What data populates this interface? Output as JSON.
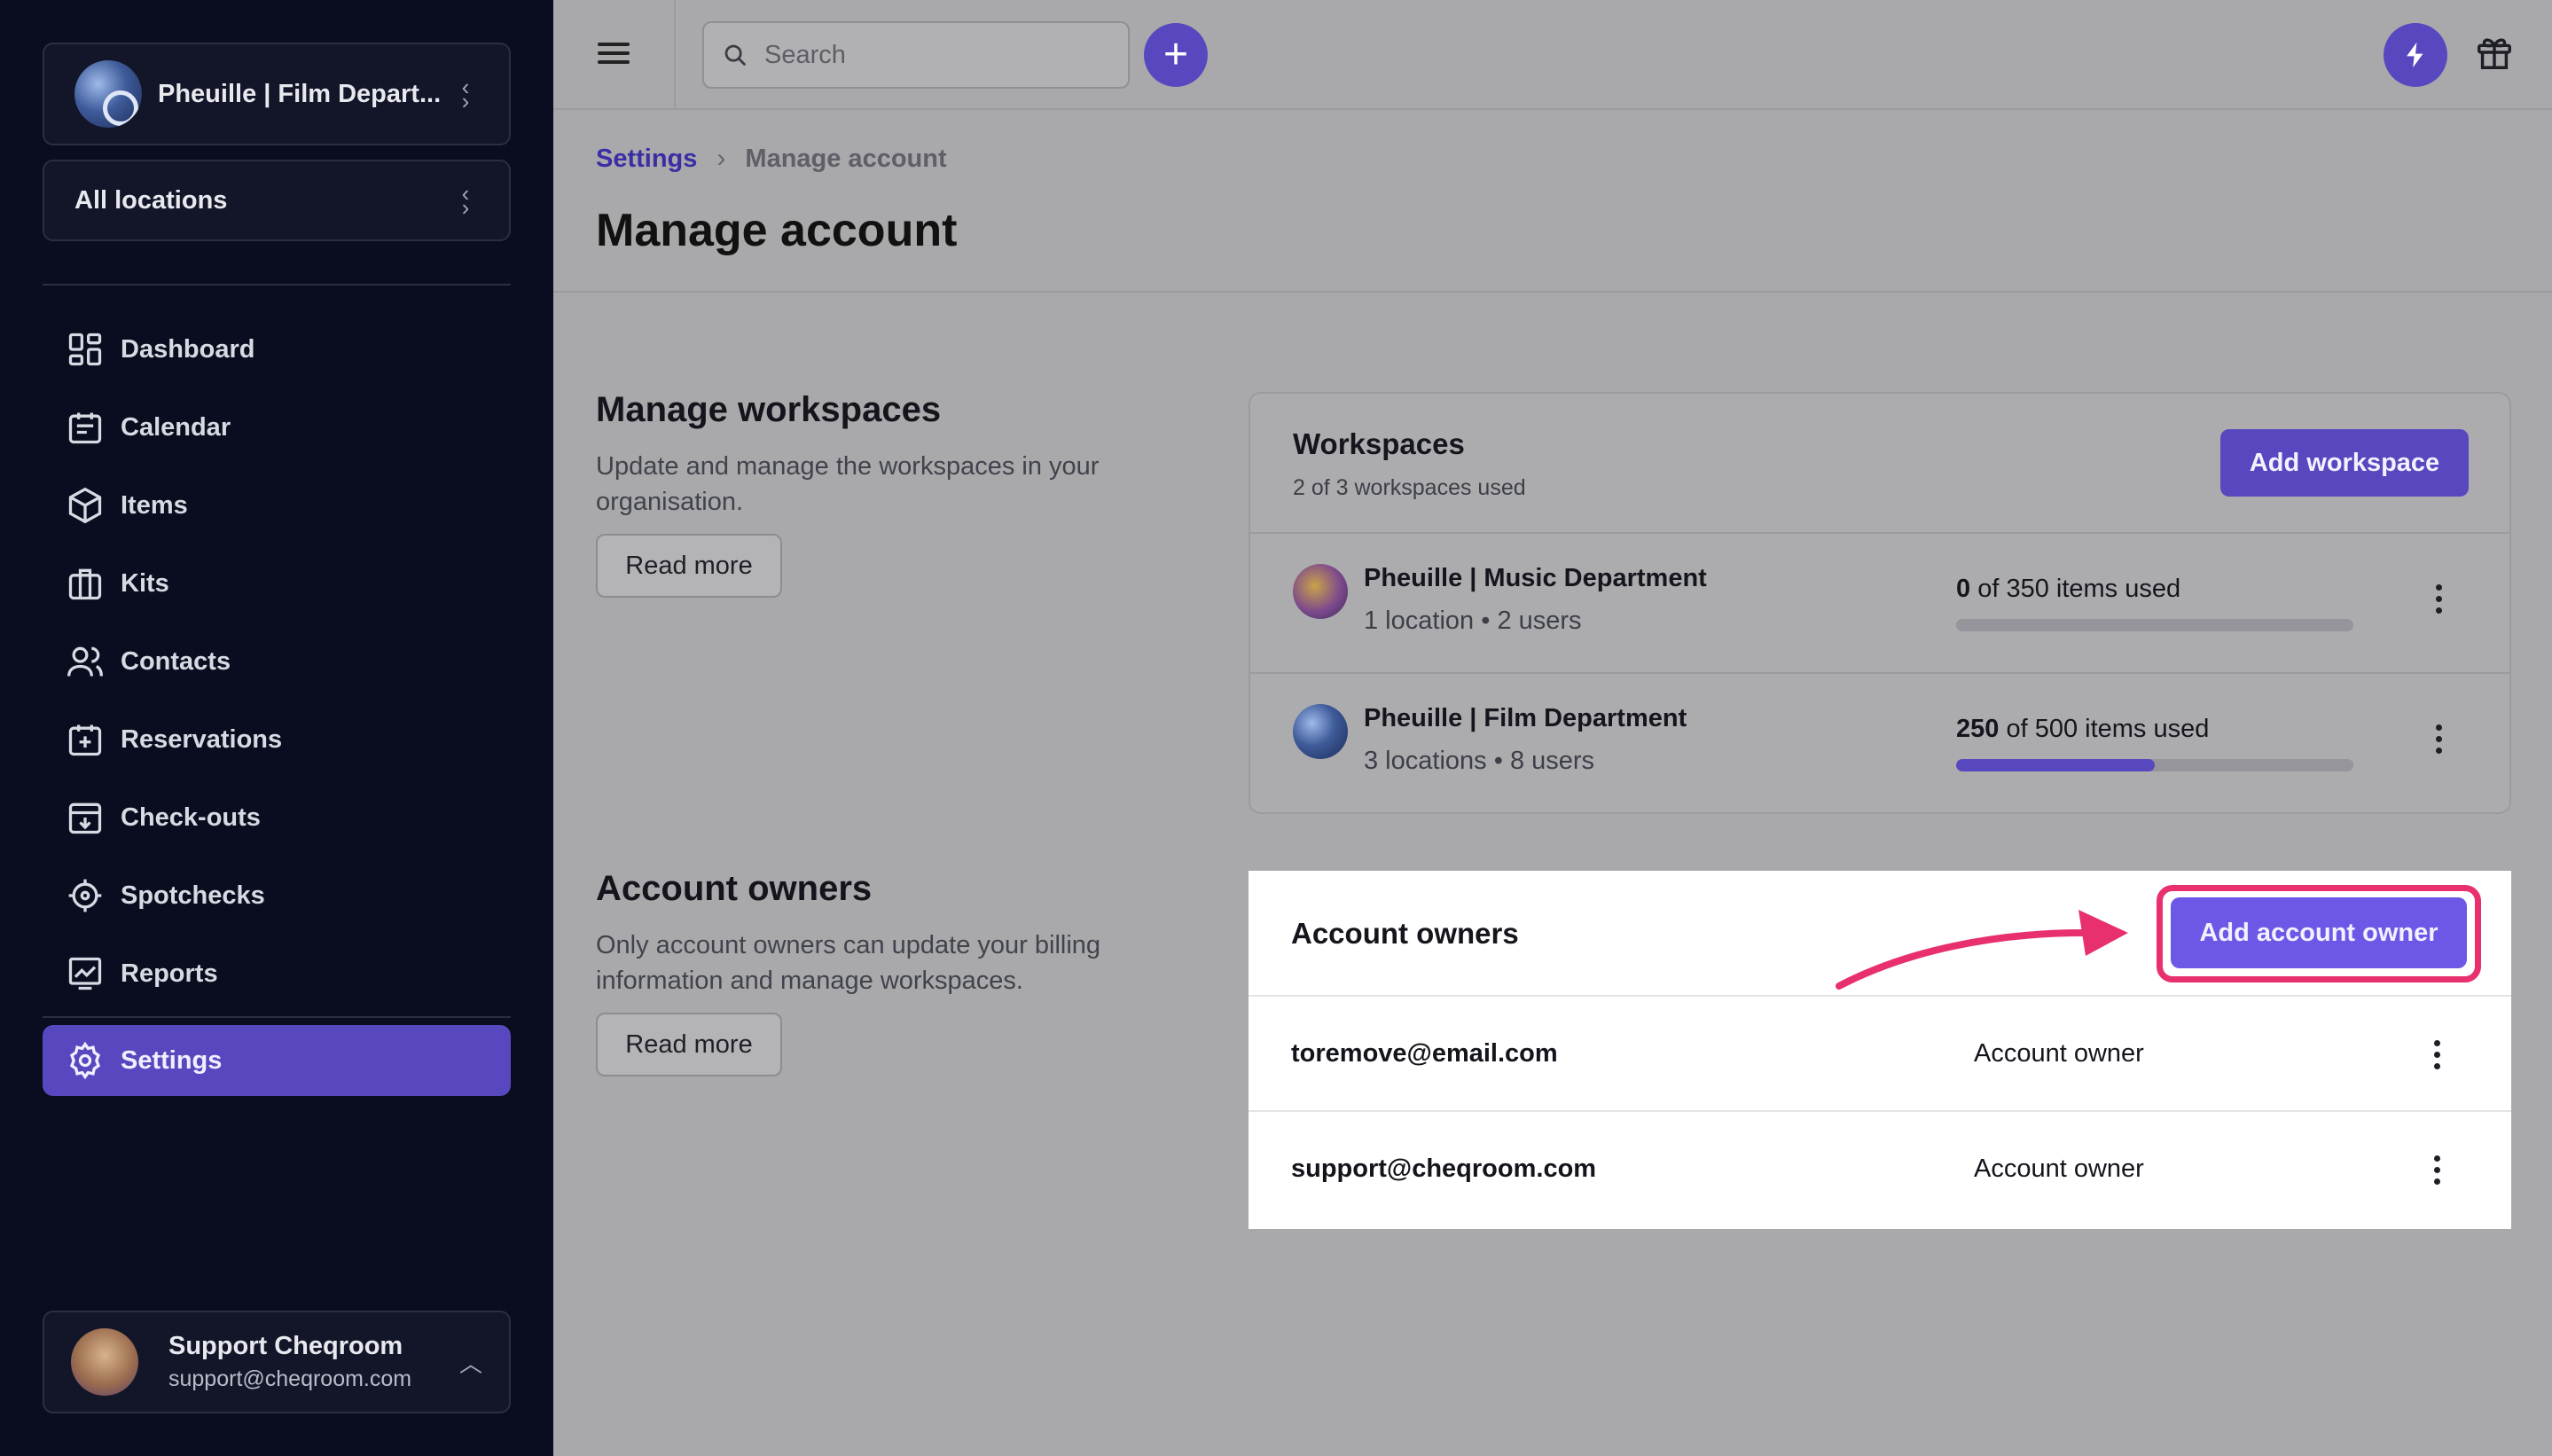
{
  "sidebar": {
    "workspace_switcher": {
      "name": "Pheuille | Film Depart..."
    },
    "location_switcher": {
      "label": "All locations"
    },
    "nav": [
      {
        "label": "Dashboard",
        "icon": "dashboard-icon"
      },
      {
        "label": "Calendar",
        "icon": "calendar-icon"
      },
      {
        "label": "Items",
        "icon": "cube-icon"
      },
      {
        "label": "Kits",
        "icon": "kit-icon"
      },
      {
        "label": "Contacts",
        "icon": "contacts-icon"
      },
      {
        "label": "Reservations",
        "icon": "calendar-plus-icon"
      },
      {
        "label": "Check-outs",
        "icon": "checkout-icon"
      },
      {
        "label": "Spotchecks",
        "icon": "crosshair-icon"
      },
      {
        "label": "Reports",
        "icon": "chart-icon"
      },
      {
        "label": "Settings",
        "icon": "gear-icon",
        "active": true
      }
    ],
    "user": {
      "name": "Support Cheqroom",
      "email": "support@cheqroom.com"
    }
  },
  "topbar": {
    "search_placeholder": "Search"
  },
  "breadcrumb": {
    "root": "Settings",
    "current": "Manage account"
  },
  "page_title": "Manage account",
  "workspaces_section": {
    "title": "Manage workspaces",
    "description": "Update and manage the workspaces in your organisation.",
    "read_more": "Read more",
    "card": {
      "title": "Workspaces",
      "subtitle": "2 of 3 workspaces used",
      "add_button": "Add workspace",
      "rows": [
        {
          "name": "Pheuille | Music Department",
          "locations": "1 location",
          "users": "2 users",
          "used": "0",
          "usage_suffix": "of 350 items used",
          "fraction": 0.0
        },
        {
          "name": "Pheuille | Film Department",
          "locations": "3 locations",
          "users": "8 users",
          "used": "250",
          "usage_suffix": "of 500 items used",
          "fraction": 0.5
        }
      ]
    }
  },
  "owners_section": {
    "title": "Account owners",
    "description": "Only account owners can update your billing information and manage workspaces.",
    "read_more": "Read more",
    "card": {
      "title": "Account owners",
      "add_button": "Add account owner",
      "rows": [
        {
          "email": "toremove@email.com",
          "role": "Account owner"
        },
        {
          "email": "support@cheqroom.com",
          "role": "Account owner"
        }
      ]
    }
  },
  "colors": {
    "accent": "#5848bf",
    "highlight": "#e8306f",
    "sidebar_bg": "#0a0d1f"
  }
}
